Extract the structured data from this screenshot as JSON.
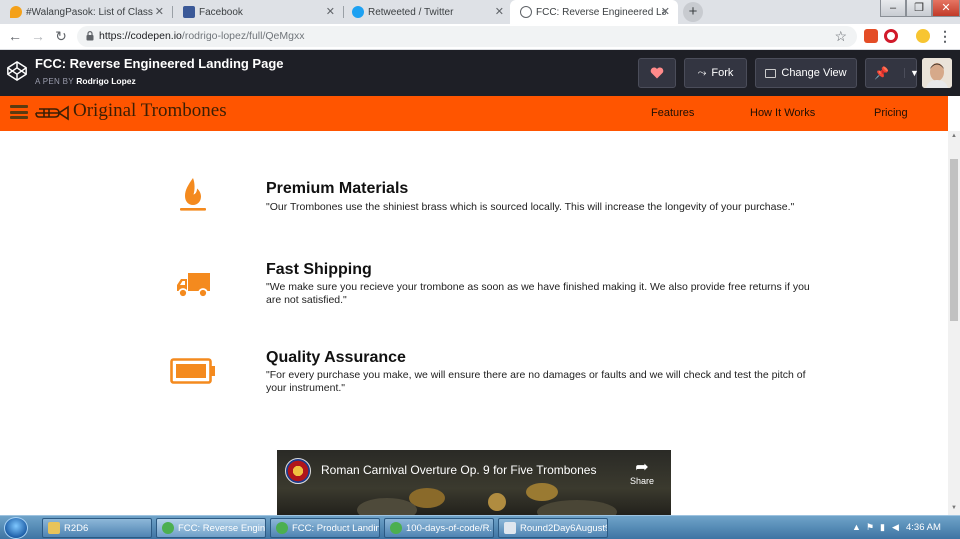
{
  "browser": {
    "tabs": [
      {
        "title": "#WalangPasok: List of Class susp",
        "favicon_color": "#f4a11a",
        "active": false
      },
      {
        "title": "Facebook",
        "favicon_color": "#3b5998",
        "active": false
      },
      {
        "title": "Retweeted / Twitter",
        "favicon_color": "#1da1f2",
        "active": false
      },
      {
        "title": "FCC: Reverse Engineered Landing",
        "favicon_color": "#5f6368",
        "active": true
      }
    ],
    "new_tab": "+",
    "window_controls": {
      "minimize": "–",
      "restore": "❐",
      "close": "✕"
    },
    "url": {
      "host": "https://codepen.io",
      "path": "/rodrigo-lopez/full/QeMgxx"
    },
    "icons": [
      "back-icon",
      "forward-icon",
      "reload-icon",
      "lock-icon",
      "star-icon",
      "menu-icon"
    ]
  },
  "codepen": {
    "title": "FCC: Reverse Engineered Landing Page",
    "pen_by_prefix": "A PEN BY",
    "author": "Rodrigo Lopez",
    "buttons": {
      "fork": "Fork",
      "change_view": "Change View"
    }
  },
  "site": {
    "brand": "Original Trombones",
    "accent": "#ff5500",
    "nav": [
      "Features",
      "How It Works",
      "Pricing"
    ],
    "features": [
      {
        "icon": "fire-icon",
        "title": "Premium Materials",
        "description": "\"Our Trombones use the shiniest brass which is sourced locally. This will increase the longevity of your purchase.\""
      },
      {
        "icon": "truck-icon",
        "title": "Fast Shipping",
        "description": "\"We make sure you recieve your trombone as soon as we have finished making it. We also provide free returns if you are not satisfied.\""
      },
      {
        "icon": "battery-icon",
        "title": "Quality Assurance",
        "description": "\"For every purchase you make, we will ensure there are no damages or faults and we will check and test the pitch of your instrument.\""
      }
    ],
    "video": {
      "title": "Roman Carnival Overture Op. 9 for Five Trombones",
      "share": "Share"
    }
  },
  "taskbar": {
    "items": [
      {
        "label": "R2D6",
        "icon_color": "#e8c45a"
      },
      {
        "label": "FCC: Reverse Engine...",
        "icon_color": "#4caf50",
        "active": true
      },
      {
        "label": "FCC: Product Landin...",
        "icon_color": "#4caf50"
      },
      {
        "label": "100-days-of-code/R...",
        "icon_color": "#4caf50"
      },
      {
        "label": "Round2Day6August9...",
        "icon_color": "#dfe6ee"
      }
    ],
    "clock": "4:36 AM"
  }
}
